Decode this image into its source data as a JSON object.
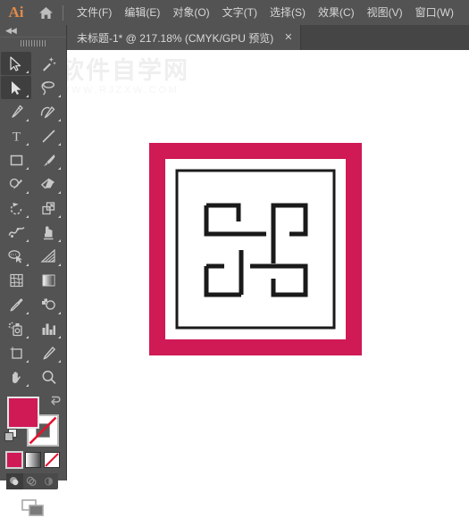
{
  "app": {
    "logo": "Ai",
    "home_icon": "home-icon"
  },
  "menubar": {
    "items": [
      {
        "label": "文件(F)",
        "name": "menu-file"
      },
      {
        "label": "编辑(E)",
        "name": "menu-edit"
      },
      {
        "label": "对象(O)",
        "name": "menu-object"
      },
      {
        "label": "文字(T)",
        "name": "menu-type"
      },
      {
        "label": "选择(S)",
        "name": "menu-select"
      },
      {
        "label": "效果(C)",
        "name": "menu-effect"
      },
      {
        "label": "视图(V)",
        "name": "menu-view"
      },
      {
        "label": "窗口(W)",
        "name": "menu-window"
      }
    ]
  },
  "document_tab": {
    "title": "未标题-1* @ 217.18% (CMYK/GPU 预览)",
    "close_label": "✕",
    "zoom_percent": "217.18%",
    "color_mode": "CMYK/GPU 预览",
    "file_name": "未标题-1*"
  },
  "toolpanel": {
    "collapse_label": "◀◀",
    "tools": [
      {
        "name": "selection-tool",
        "selected": true
      },
      {
        "name": "magic-wand-tool",
        "selected": false
      },
      {
        "name": "direct-selection-tool",
        "selected": true
      },
      {
        "name": "lasso-tool",
        "selected": false
      },
      {
        "name": "pen-tool",
        "selected": false
      },
      {
        "name": "curvature-tool",
        "selected": false
      },
      {
        "name": "type-tool",
        "selected": false
      },
      {
        "name": "line-segment-tool",
        "selected": false
      },
      {
        "name": "rectangle-tool",
        "selected": false
      },
      {
        "name": "paintbrush-tool",
        "selected": false
      },
      {
        "name": "shaper-pencil-tool",
        "selected": false
      },
      {
        "name": "eraser-tool",
        "selected": false
      },
      {
        "name": "rotate-tool",
        "selected": false
      },
      {
        "name": "scale-tool",
        "selected": false
      },
      {
        "name": "width-warp-tool",
        "selected": false
      },
      {
        "name": "free-transform-tool",
        "selected": false
      },
      {
        "name": "shape-builder-tool",
        "selected": false
      },
      {
        "name": "perspective-grid-tool",
        "selected": false
      },
      {
        "name": "mesh-tool",
        "selected": false
      },
      {
        "name": "gradient-tool",
        "selected": false
      },
      {
        "name": "eyedropper-tool",
        "selected": false
      },
      {
        "name": "blend-tool",
        "selected": false
      },
      {
        "name": "symbol-sprayer-tool",
        "selected": false
      },
      {
        "name": "column-graph-tool",
        "selected": false
      },
      {
        "name": "artboard-tool",
        "selected": false
      },
      {
        "name": "slice-tool",
        "selected": false
      },
      {
        "name": "hand-tool",
        "selected": false
      },
      {
        "name": "zoom-tool",
        "selected": false
      }
    ]
  },
  "colors": {
    "fill": "#cf1a56",
    "stroke": "none",
    "accent_pink": "#cf1a56",
    "panel_bg": "#535353",
    "tabbar_bg": "#454545",
    "menu_text": "#d6d6d6",
    "logo_orange": "#e08a4b",
    "artwork_border": "#cf1a56",
    "artwork_line": "#1a1a1a",
    "canvas_bg": "#ffffff",
    "fill_mode": "color",
    "draw_mode": "draw-normal"
  },
  "watermark": {
    "main": "软件自学网",
    "sub": "WWW.RJZXW.COM"
  },
  "artwork": {
    "name": "maze-square-logo",
    "outer_size": 238,
    "pink_border_width": 18,
    "white_gap": 12,
    "inner_stroke": 3,
    "description": "Pink square frame with white inset and black maze pattern of four hooked L-shapes"
  }
}
